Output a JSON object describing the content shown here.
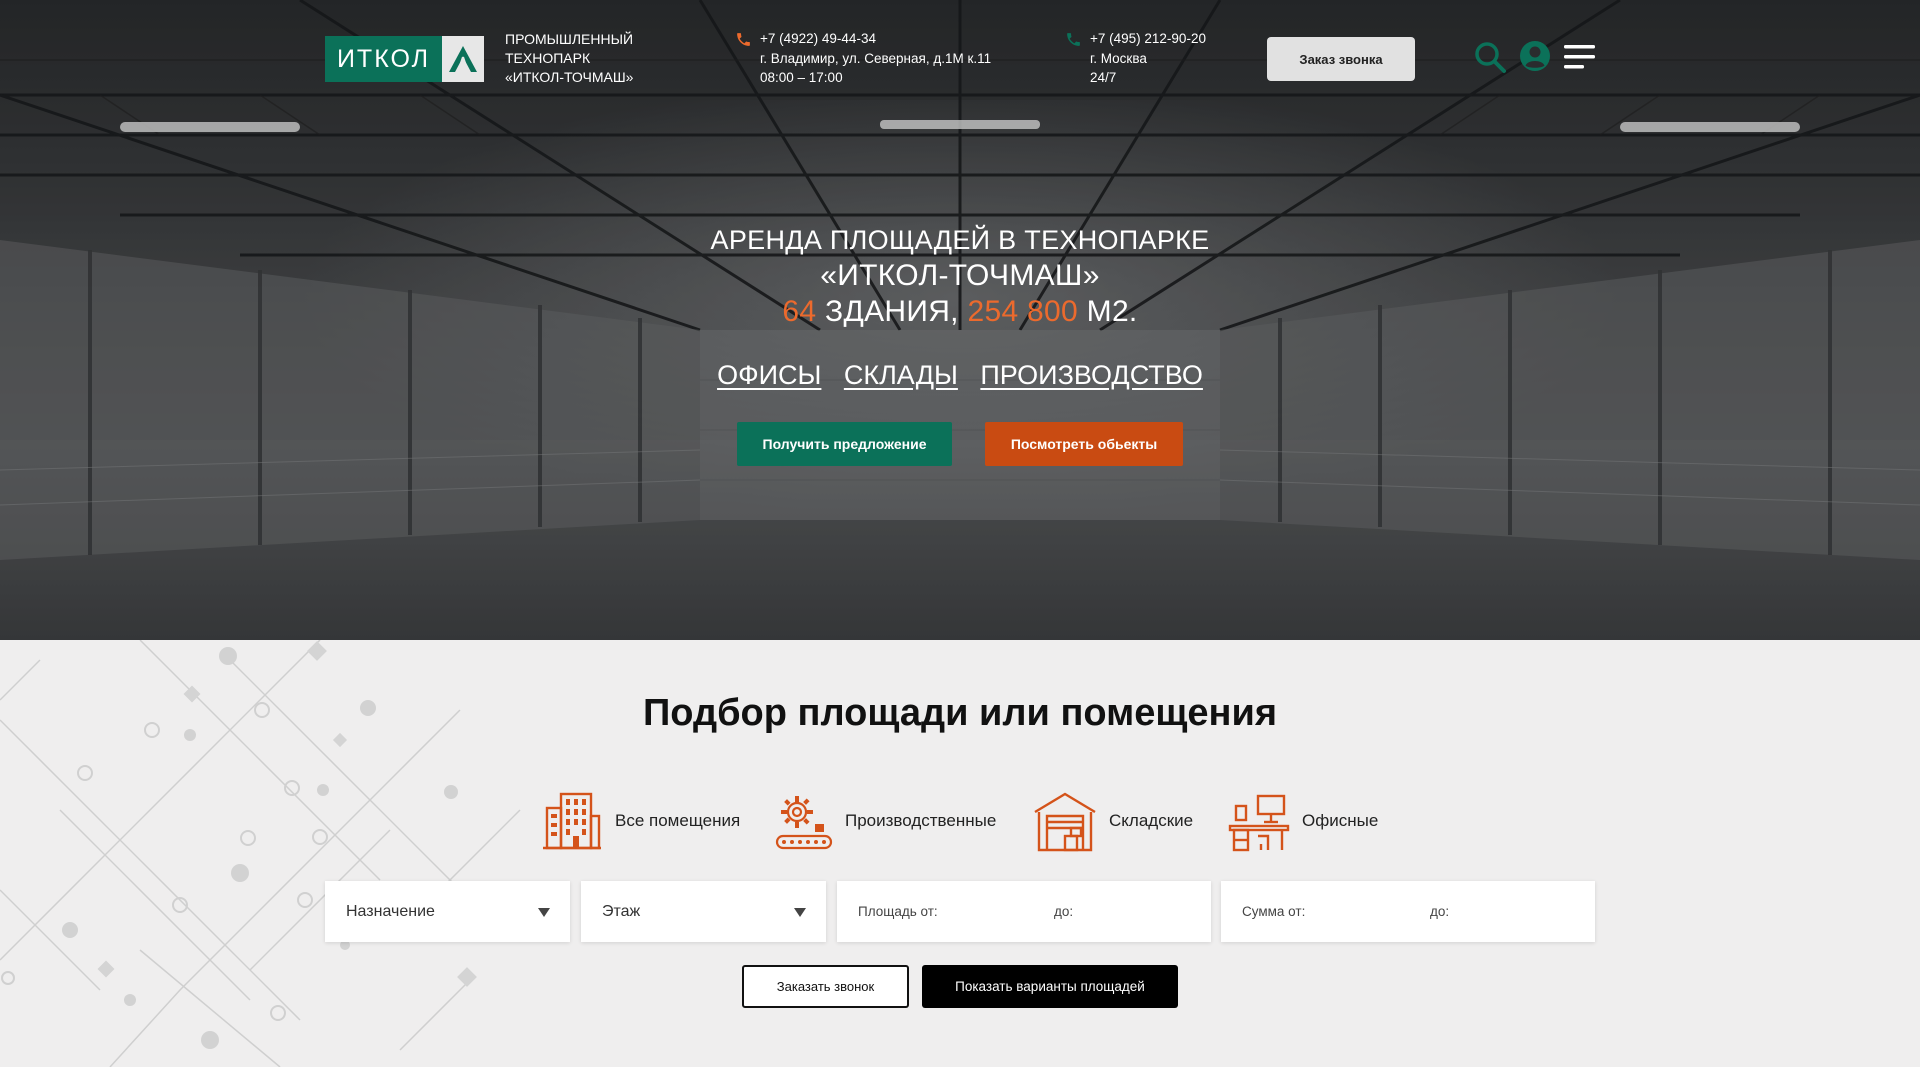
{
  "header": {
    "logo_text": "ИТКОЛ",
    "park_name": [
      "ПРОМЫШЛЕННЫЙ",
      "ТЕХНОПАРК",
      "«ИТКОЛ-ТОЧМАШ»"
    ],
    "contact1": {
      "phone": "+7 (4922) 49-44-34",
      "address": "г. Владимир, ул. Северная, д.1М к.11",
      "hours": "08:00 – 17:00"
    },
    "contact2": {
      "phone": "+7 (495) 212-90-20",
      "city": "г. Москва",
      "hours": "24/7"
    },
    "callback_label": "Заказ звонка"
  },
  "hero": {
    "title_line1": "АРЕНДА ПЛОЩАДЕЙ В ТЕХНОПАРКЕ",
    "title_line2": "«ИТКОЛ-ТОЧМАШ»",
    "buildings_count": "64",
    "buildings_label": "ЗДАНИЯ,",
    "area_value": "254 800",
    "area_unit": "М2.",
    "links": [
      "ОФИСЫ",
      "СКЛАДЫ",
      "ПРОИЗВОДСТВО"
    ],
    "btn_offer": "Получить предложение",
    "btn_objects": "Посмотреть обьекты"
  },
  "selection": {
    "title": "Подбор площади или помещения",
    "categories": [
      "Все помещения",
      "Производственные",
      "Складские",
      "Офисные"
    ],
    "purpose_placeholder": "Назначение",
    "floor_placeholder": "Этаж",
    "area_from": "Площадь от:",
    "area_to": "до:",
    "sum_from": "Сумма от:",
    "sum_to": "до:",
    "btn_call": "Заказать звонок",
    "btn_show": "Показать варианты площадей"
  },
  "colors": {
    "green": "#0b7159",
    "orange": "#c94b12",
    "accent": "#ec6a2d",
    "icon_orange": "#d4531a"
  }
}
